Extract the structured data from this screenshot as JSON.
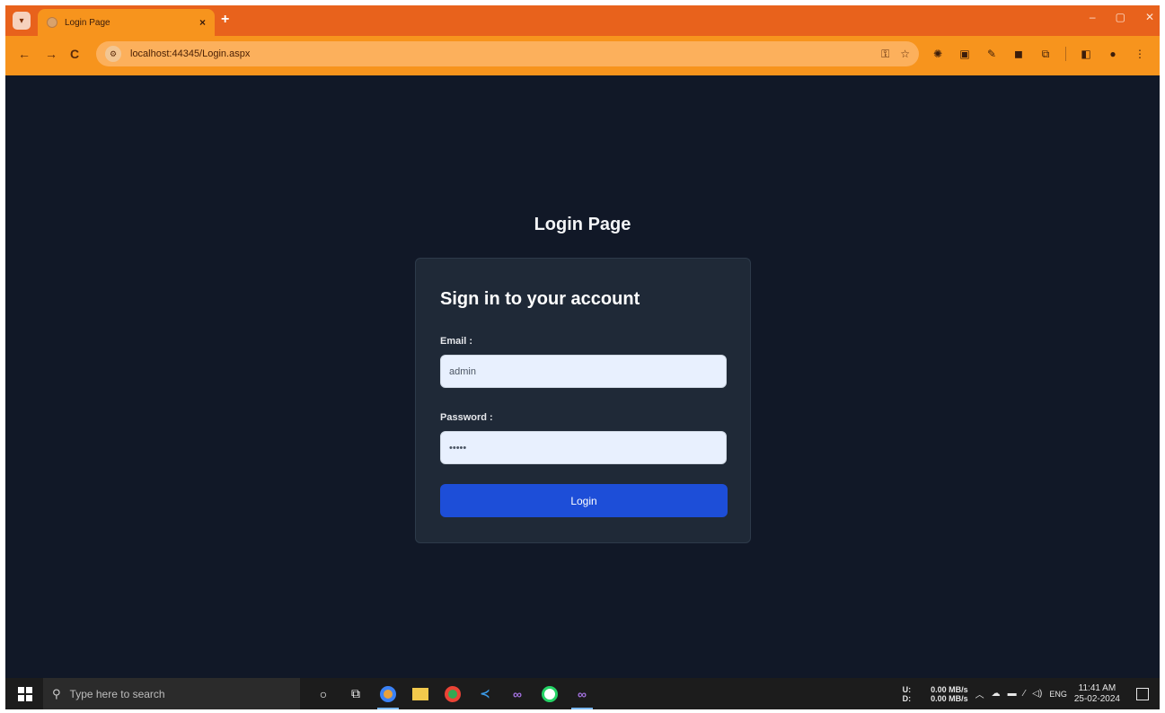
{
  "browser": {
    "tab_title": "Login Page",
    "tab_close": "×",
    "new_tab": "+",
    "url": "localhost:44345/Login.aspx",
    "win_min": "–",
    "win_max": "▢",
    "win_close": "✕"
  },
  "page": {
    "title": "Login Page",
    "card_heading": "Sign in to your account",
    "email_label": "Email :",
    "email_value": "admin",
    "password_label": "Password :",
    "password_value": "admin",
    "login_label": "Login"
  },
  "taskbar": {
    "search_placeholder": "Type here to search",
    "net_up_label": "U:",
    "net_down_label": "D:",
    "net_up": "0.00 MB/s",
    "net_down": "0.00 MB/s",
    "lang": "ENG",
    "time": "11:41 AM",
    "date": "25-02-2024"
  },
  "colors": {
    "tabbar": "#e8621c",
    "toolbar": "#f7941d",
    "page_bg": "#111827",
    "card_bg": "#1f2937",
    "button": "#1d4ed8"
  }
}
